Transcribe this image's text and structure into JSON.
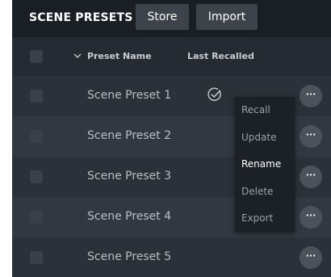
{
  "header": {
    "title": "SCENE PRESETS",
    "store_label": "Store",
    "import_label": "Import"
  },
  "columns": {
    "name": "Preset Name",
    "last_recalled": "Last Recalled"
  },
  "rows": [
    {
      "name": "Scene Preset 1",
      "last_recalled": true
    },
    {
      "name": "Scene Preset 2",
      "last_recalled": false
    },
    {
      "name": "Scene Preset 3",
      "last_recalled": false
    },
    {
      "name": "Scene Preset 4",
      "last_recalled": false
    },
    {
      "name": "Scene Preset 5",
      "last_recalled": false
    }
  ],
  "context_menu": {
    "items": [
      "Recall",
      "Update",
      "Rename",
      "Delete",
      "Export"
    ],
    "highlighted": "Rename"
  },
  "more_button_label": "···",
  "icons": {
    "sort": "chevron-down-icon",
    "recalled": "check-circle-icon",
    "more": "more-horizontal-icon"
  },
  "colors": {
    "panel": "#252b33",
    "header": "#1a1f25",
    "row": "#2b3139",
    "row_alt": "#323842",
    "menu": "#1c2128"
  }
}
